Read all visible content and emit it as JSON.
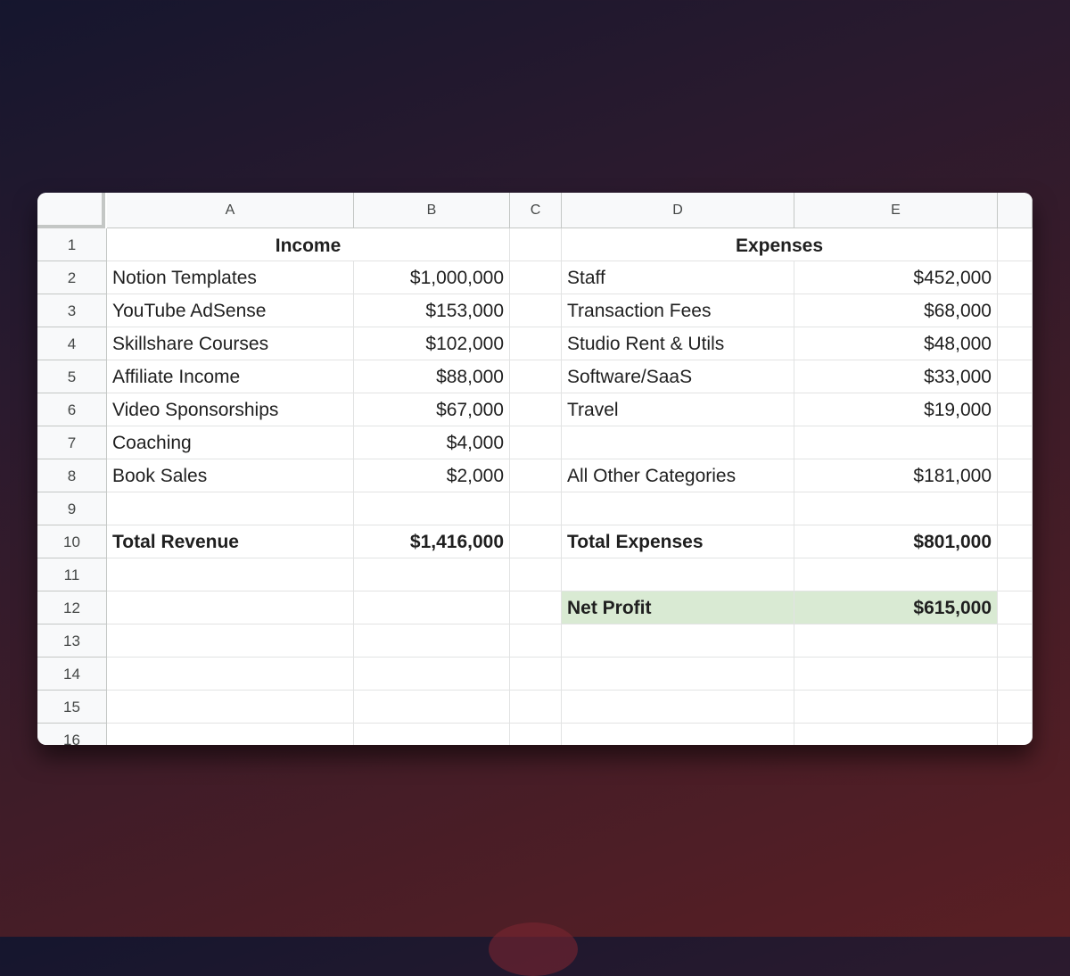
{
  "columns": [
    "A",
    "B",
    "C",
    "D",
    "E"
  ],
  "rows": [
    "1",
    "2",
    "3",
    "4",
    "5",
    "6",
    "7",
    "8",
    "9",
    "10",
    "11",
    "12",
    "13",
    "14",
    "15",
    "16"
  ],
  "income": {
    "header": "Income",
    "items": [
      {
        "label": "Notion Templates",
        "value": "$1,000,000"
      },
      {
        "label": "YouTube AdSense",
        "value": "$153,000"
      },
      {
        "label": "Skillshare Courses",
        "value": "$102,000"
      },
      {
        "label": "Affiliate Income",
        "value": "$88,000"
      },
      {
        "label": "Video Sponsorships",
        "value": "$67,000"
      },
      {
        "label": "Coaching",
        "value": "$4,000"
      },
      {
        "label": "Book Sales",
        "value": "$2,000"
      }
    ],
    "total_label": "Total Revenue",
    "total_value": "$1,416,000"
  },
  "expenses": {
    "header": "Expenses",
    "items": [
      {
        "label": "Staff",
        "value": "$452,000"
      },
      {
        "label": "Transaction Fees",
        "value": "$68,000"
      },
      {
        "label": "Studio Rent & Utils",
        "value": "$48,000"
      },
      {
        "label": "Software/SaaS",
        "value": "$33,000"
      },
      {
        "label": "Travel",
        "value": "$19,000"
      }
    ],
    "other_label": "All Other Categories",
    "other_value": "$181,000",
    "total_label": "Total Expenses",
    "total_value": "$801,000"
  },
  "net_profit": {
    "label": "Net Profit",
    "value": "$615,000",
    "highlight_color": "#d9ead3"
  }
}
